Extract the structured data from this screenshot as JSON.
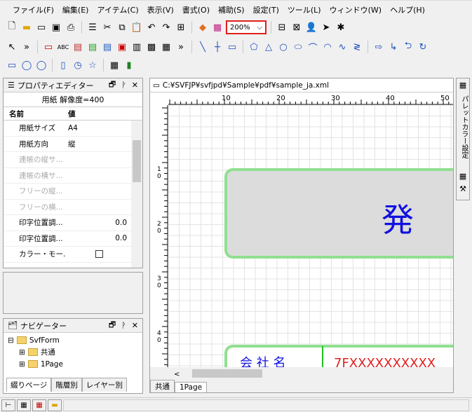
{
  "menu": [
    "ファイル(F)",
    "編集(E)",
    "アイテム(C)",
    "表示(V)",
    "書式(O)",
    "補助(S)",
    "設定(T)",
    "ツール(L)",
    "ウィンドウ(W)",
    "ヘルプ(H)"
  ],
  "zoom": "200%",
  "props": {
    "title": "プロパティエディター",
    "subtitle": "用紙 解像度=400",
    "col_name": "名前",
    "col_value": "値",
    "rows": [
      {
        "n": "用紙サイズ",
        "v": "A4"
      },
      {
        "n": "用紙方向",
        "v": "縦"
      },
      {
        "n": "連帳の縦サ...",
        "v": ""
      },
      {
        "n": "連帳の横サ...",
        "v": ""
      },
      {
        "n": "フリーの縦...",
        "v": ""
      },
      {
        "n": "フリーの横...",
        "v": ""
      },
      {
        "n": "印字位置調...",
        "v": "0.0"
      },
      {
        "n": "印字位置調...",
        "v": "0.0"
      },
      {
        "n": "カラー・モー...",
        "v": ""
      }
    ]
  },
  "nav": {
    "title": "ナビゲーター",
    "root": "SvfForm",
    "items": [
      "共通",
      "1Page"
    ],
    "tabs": [
      "綴りページ",
      "階層別",
      "レイヤー別"
    ]
  },
  "doc": {
    "path": "C:¥SVFJP¥svfjpd¥Sample¥pdf¥sample_ja.xml",
    "ruler_top": [
      "10",
      "20",
      "30",
      "40",
      "50"
    ],
    "ruler_left": [
      "1\n0",
      "2\n0",
      "3\n0",
      "4\n0"
    ],
    "big_char": "発",
    "row_text_left": "会 社 名",
    "row_text_right": "7FXXXXXXXXXX",
    "tabs": [
      "共通",
      "1Page"
    ]
  },
  "right_panel": {
    "label": "パレットカラー設定"
  }
}
